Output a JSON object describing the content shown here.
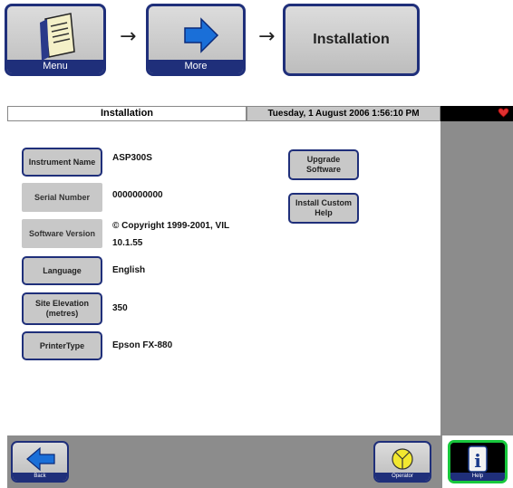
{
  "nav": {
    "menu_label": "Menu",
    "more_label": "More",
    "installation_label": "Installation",
    "separator": "→"
  },
  "screen": {
    "title": "Installation",
    "datetime": "Tuesday, 1 August 2006 1:56:10 PM"
  },
  "settings": {
    "instrument_name_label": "Instrument Name",
    "instrument_name_value": "ASP300S",
    "serial_number_label": "Serial Number",
    "serial_number_value": "0000000000",
    "software_version_label": "Software Version",
    "software_version_copyright": "© Copyright 1999-2001, VIL",
    "software_version_value": "10.1.55",
    "language_label": "Language",
    "language_value": "English",
    "site_elevation_label": "Site Elevation (metres)",
    "site_elevation_value": "350",
    "printer_type_label": "PrinterType",
    "printer_type_value": "Epson FX-880"
  },
  "actions": {
    "upgrade_software_label": "Upgrade\nSoftware",
    "install_custom_help_label": "Install Custom\nHelp"
  },
  "bottom": {
    "back_label": "Back",
    "operator_label": "Operator",
    "help_label": "Help"
  },
  "colors": {
    "button_border": "#1f2f7a",
    "button_fill": "#c8c8c8",
    "panel_gray": "#8c8c8c",
    "help_border": "#18c83c",
    "back_arrow": "#1a6fd8"
  }
}
